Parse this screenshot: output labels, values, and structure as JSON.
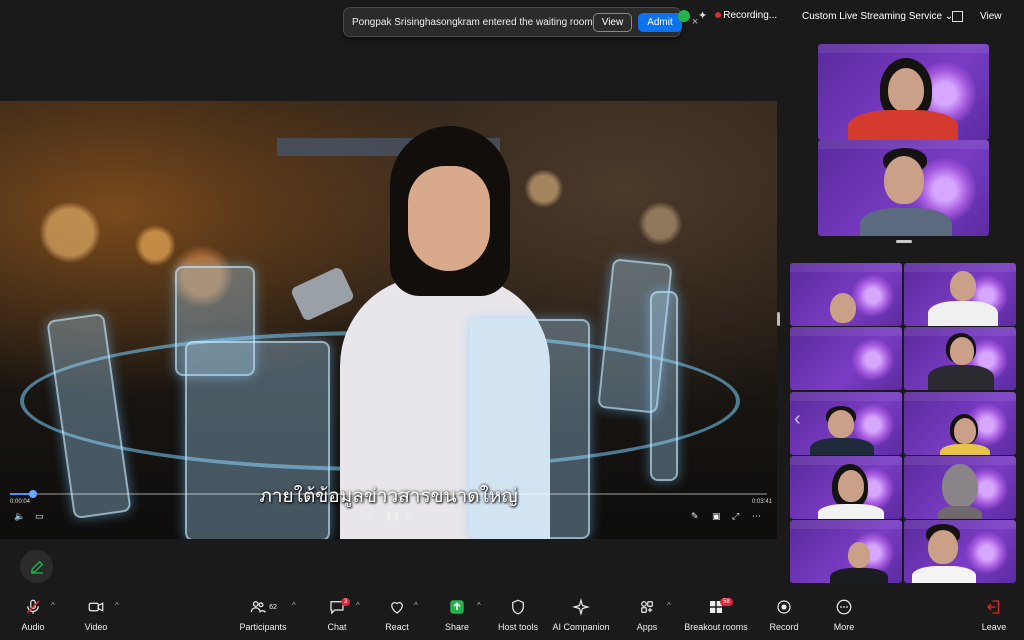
{
  "notification": {
    "message": "Pongpak Srisinghasongkram entered the waiting room",
    "view_label": "View",
    "admit_label": "Admit",
    "close_glyph": "×"
  },
  "topbar": {
    "recording_label": "Recording...",
    "stream_label": "Custom Live Streaming Service",
    "view_label": "View",
    "icons": [
      "shield-check-icon",
      "sparkle-icon",
      "grid-icon"
    ]
  },
  "shared_video": {
    "subtitle": "ภายใต้ข้อมูลข่าวสารขนาดใหญ่",
    "time_elapsed": "0:00:04",
    "time_total": "0:03:41",
    "progress_fraction": 0.03
  },
  "toolbar": {
    "audio": "Audio",
    "video": "Video",
    "participants": "Participants",
    "participants_count": "62",
    "chat": "Chat",
    "chat_badge": "3",
    "react": "React",
    "share": "Share",
    "host_tools": "Host tools",
    "ai_companion": "AI Companion",
    "apps": "Apps",
    "breakout_rooms": "Breakout rooms",
    "breakout_badge": "58",
    "record": "Record",
    "more": "More",
    "leave": "Leave",
    "colors": {
      "share_green": "#23b24b",
      "leave_red": "#e02828",
      "accent_blue": "#0e72ed"
    }
  }
}
